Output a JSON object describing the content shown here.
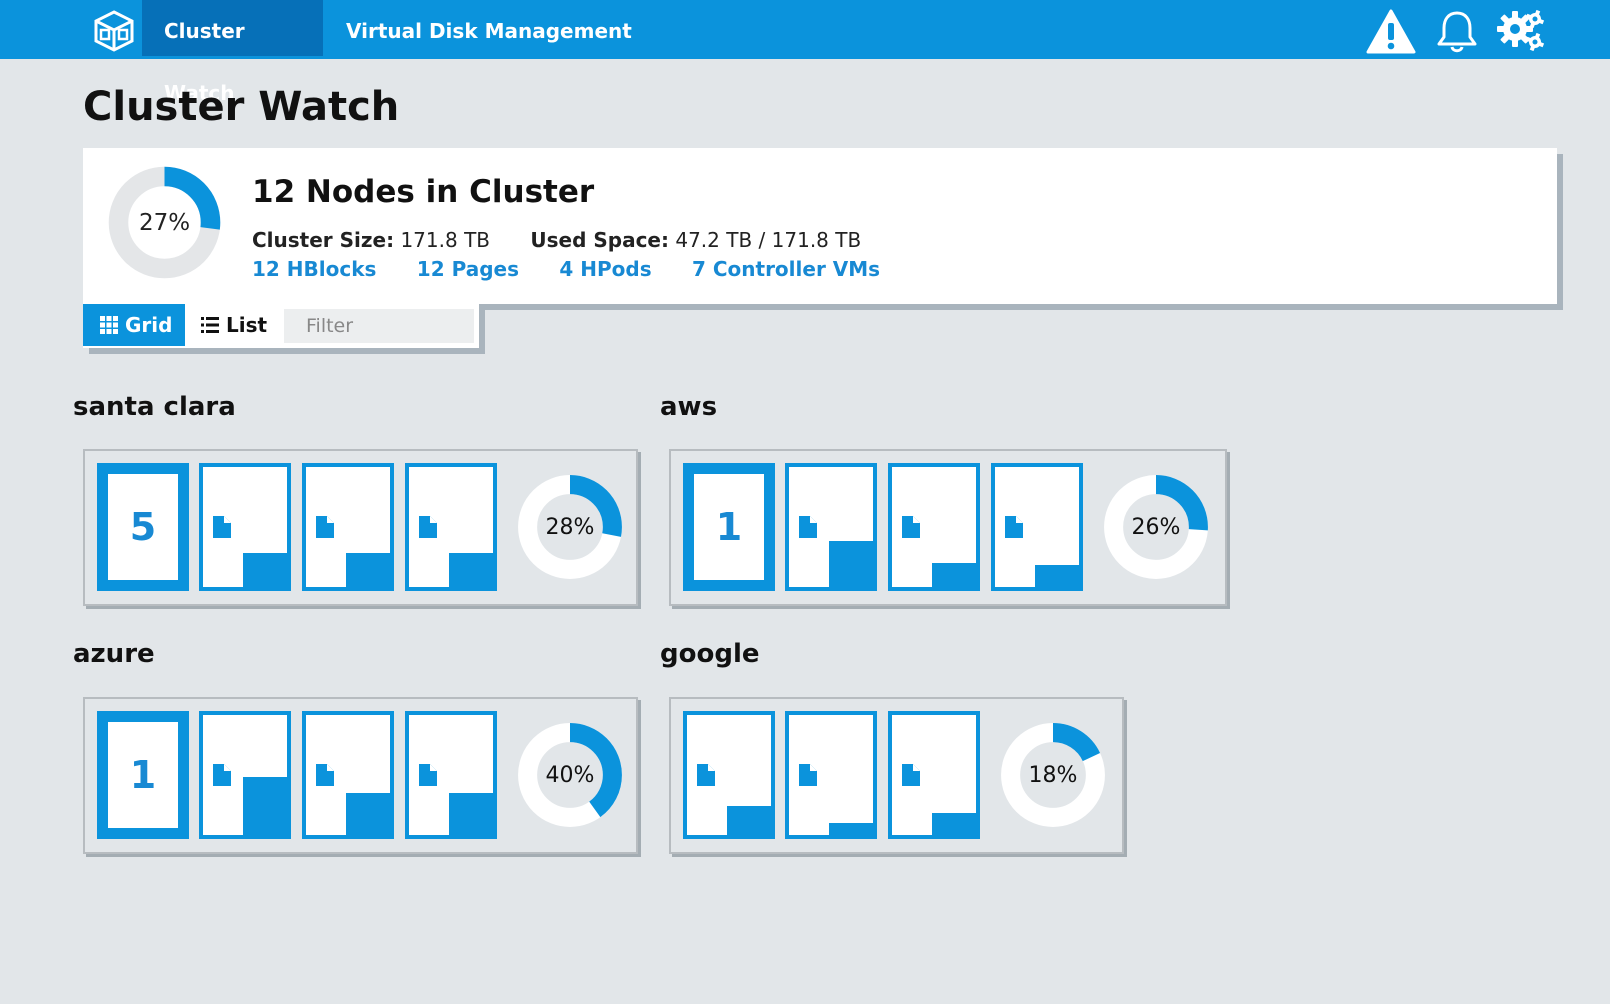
{
  "nav": {
    "tabs": [
      {
        "label": "Cluster Watch",
        "active": true
      },
      {
        "label": "Virtual Disk Management",
        "active": false
      }
    ],
    "icons": [
      "warning-icon",
      "bell-icon",
      "settings-icon"
    ]
  },
  "page_title": "Cluster Watch",
  "summary": {
    "percent": 27,
    "percent_label": "27%",
    "title": "12 Nodes in Cluster",
    "cluster_size_label": "Cluster Size:",
    "cluster_size_value": "171.8 TB",
    "used_space_label": "Used Space:",
    "used_space_value": "47.2 TB / 171.8 TB",
    "links": [
      "12 HBlocks",
      "12 Pages",
      "4 HPods",
      "7 Controller VMs"
    ]
  },
  "toolbar": {
    "grid_label": "Grid",
    "list_label": "List",
    "filter_placeholder": "Filter"
  },
  "groups": [
    {
      "name": "santa clara",
      "count": "5",
      "tile_fill": [
        0.28,
        0.28,
        0.28
      ],
      "percent": 28,
      "percent_label": "28%"
    },
    {
      "name": "aws",
      "count": "1",
      "tile_fill": [
        0.38,
        0.2,
        0.18
      ],
      "percent": 26,
      "percent_label": "26%"
    },
    {
      "name": "azure",
      "count": "1",
      "tile_fill": [
        0.48,
        0.35,
        0.35
      ],
      "percent": 40,
      "percent_label": "40%"
    },
    {
      "name": "google",
      "count": "",
      "tile_fill": [
        0.24,
        0.1,
        0.18
      ],
      "percent": 18,
      "percent_label": "18%"
    }
  ],
  "colors": {
    "accent": "#0b93dc",
    "accent_dark": "#0670b8",
    "link": "#1889d3",
    "donut_track_summary": "#e4e6e8",
    "donut_track_group": "#ffffff"
  }
}
